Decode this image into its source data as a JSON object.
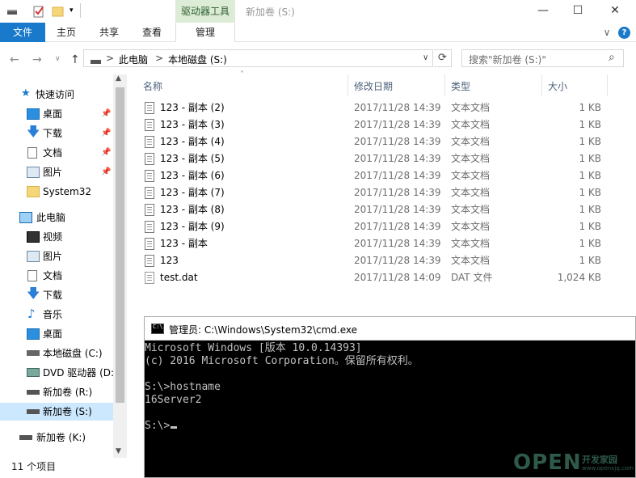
{
  "titlebar": {
    "context_group": "驱动器工具",
    "window_title": "新加卷 (S:)",
    "minimize": "—",
    "maximize": "☐",
    "close": "✕"
  },
  "ribbon": {
    "tabs": [
      "文件",
      "主页",
      "共享",
      "查看",
      "管理"
    ],
    "collapse": "∨",
    "help": "?"
  },
  "address": {
    "back": "←",
    "forward": "→",
    "recent": "∨",
    "up": "↑",
    "path": [
      "此电脑",
      "本地磁盘 (S:)"
    ],
    "sep": ">",
    "dropdown": "∨",
    "refresh": "⟳",
    "search_placeholder": "搜索\"新加卷 (S:)\"",
    "search_icon": "⌕"
  },
  "nav": {
    "quick_access": "快速访问",
    "quick_items": [
      "桌面",
      "下载",
      "文档",
      "图片",
      "System32"
    ],
    "this_pc": "此电脑",
    "pc_items": [
      "视频",
      "图片",
      "文档",
      "下载",
      "音乐",
      "桌面",
      "本地磁盘 (C:)",
      "DVD 驱动器 (D:",
      "新加卷 (R:)",
      "新加卷 (S:)"
    ],
    "network": "新加卷 (K:)"
  },
  "columns": {
    "name": "名称",
    "date": "修改日期",
    "type": "类型",
    "size": "大小"
  },
  "files": [
    {
      "name": "123 - 副本 (2)",
      "date": "2017/11/28 14:39",
      "type": "文本文档",
      "size": "1 KB"
    },
    {
      "name": "123 - 副本 (3)",
      "date": "2017/11/28 14:39",
      "type": "文本文档",
      "size": "1 KB"
    },
    {
      "name": "123 - 副本 (4)",
      "date": "2017/11/28 14:39",
      "type": "文本文档",
      "size": "1 KB"
    },
    {
      "name": "123 - 副本 (5)",
      "date": "2017/11/28 14:39",
      "type": "文本文档",
      "size": "1 KB"
    },
    {
      "name": "123 - 副本 (6)",
      "date": "2017/11/28 14:39",
      "type": "文本文档",
      "size": "1 KB"
    },
    {
      "name": "123 - 副本 (7)",
      "date": "2017/11/28 14:39",
      "type": "文本文档",
      "size": "1 KB"
    },
    {
      "name": "123 - 副本 (8)",
      "date": "2017/11/28 14:39",
      "type": "文本文档",
      "size": "1 KB"
    },
    {
      "name": "123 - 副本 (9)",
      "date": "2017/11/28 14:39",
      "type": "文本文档",
      "size": "1 KB"
    },
    {
      "name": "123 - 副本",
      "date": "2017/11/28 14:39",
      "type": "文本文档",
      "size": "1 KB"
    },
    {
      "name": "123",
      "date": "2017/11/28 14:39",
      "type": "文本文档",
      "size": "1 KB"
    },
    {
      "name": "test.dat",
      "date": "2017/11/28 14:09",
      "type": "DAT 文件",
      "size": "1,024 KB"
    }
  ],
  "status": {
    "count": "11 个项目"
  },
  "cmd": {
    "title": "管理员: C:\\Windows\\System32\\cmd.exe",
    "lines": [
      "Microsoft Windows [版本 10.0.14393]",
      "(c) 2016 Microsoft Corporation。保留所有权利。",
      "",
      "S:\\>hostname",
      "16Server2",
      "",
      "S:\\>"
    ]
  },
  "watermark": {
    "logo": "OPEN",
    "cn": "开发家园",
    "url": "www.openxjq.com"
  },
  "colors": {
    "file_tab": "#1979ca",
    "selection": "#cce8ff",
    "context_tab": "#dcecd6",
    "header_text": "#4c607a"
  }
}
